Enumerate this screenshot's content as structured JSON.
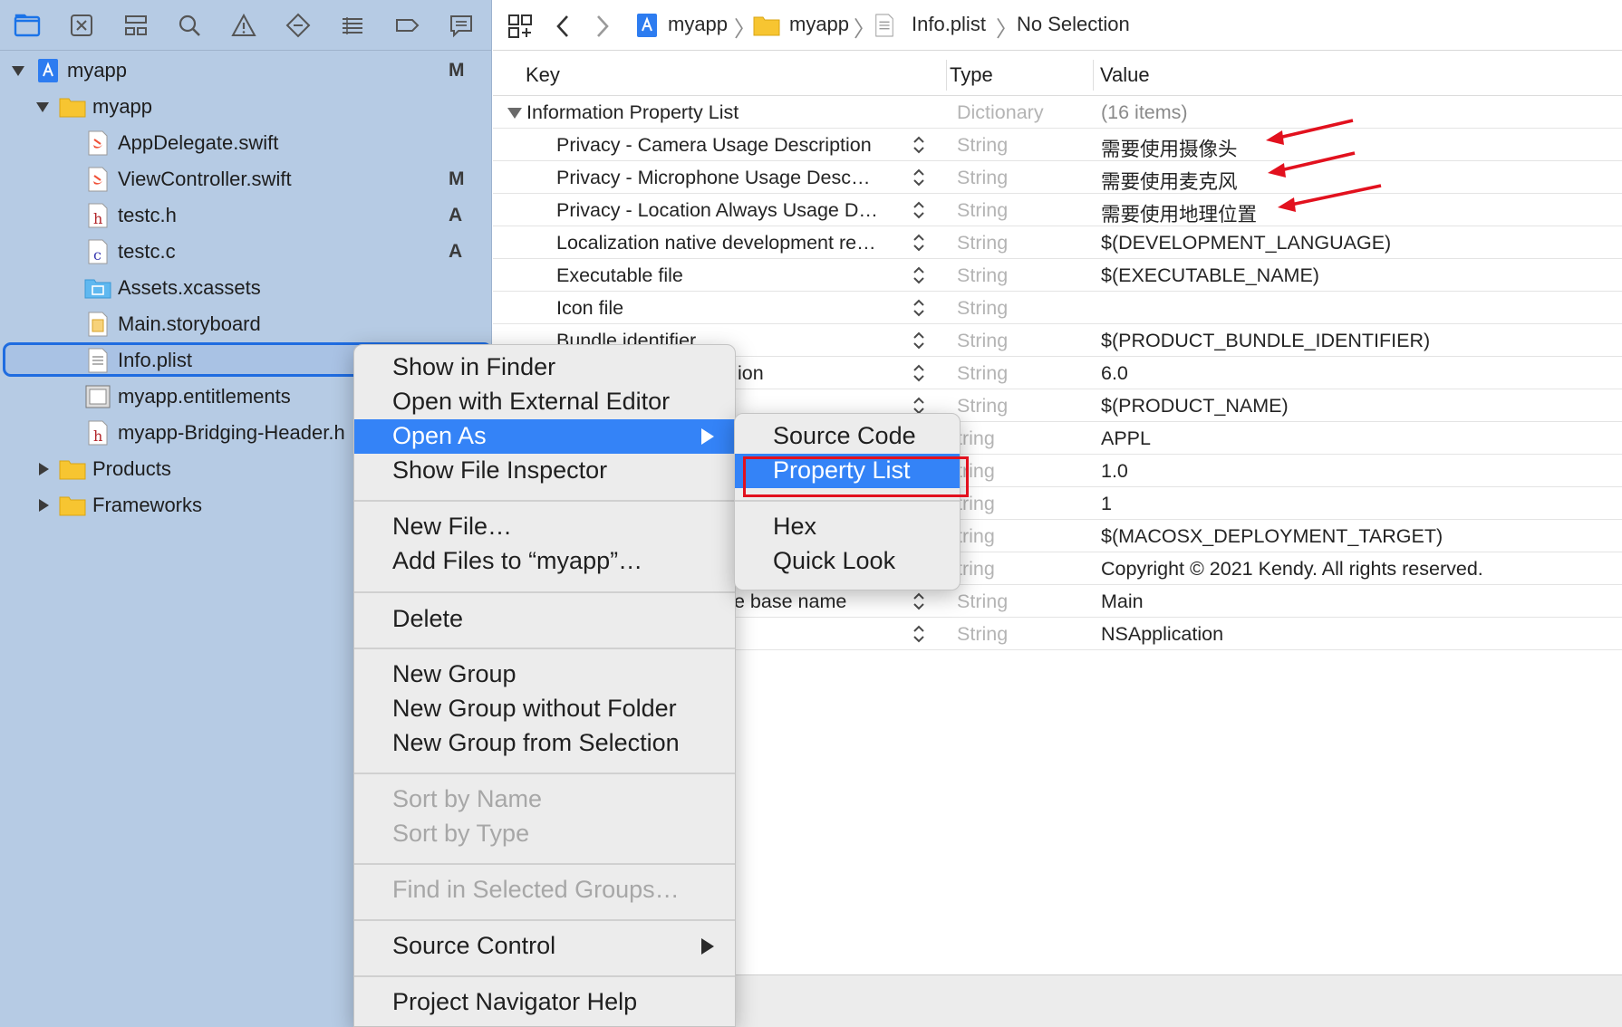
{
  "navigator": {
    "toolbar_icons": [
      "folder-icon",
      "source-control-icon",
      "symbol-icon",
      "find-icon",
      "issue-icon",
      "test-icon",
      "debug-icon",
      "breakpoint-icon",
      "report-icon"
    ],
    "tree": [
      {
        "label": "myapp",
        "badge": "M",
        "icon": "project-icon",
        "disclosure": "open"
      },
      {
        "label": "myapp",
        "badge": "",
        "icon": "folder-icon",
        "disclosure": "open"
      },
      {
        "label": "AppDelegate.swift",
        "badge": "",
        "icon": "swift-file-icon"
      },
      {
        "label": "ViewController.swift",
        "badge": "M",
        "icon": "swift-file-icon"
      },
      {
        "label": "testc.h",
        "badge": "A",
        "icon": "header-file-icon"
      },
      {
        "label": "testc.c",
        "badge": "A",
        "icon": "c-file-icon"
      },
      {
        "label": "Assets.xcassets",
        "badge": "",
        "icon": "asset-catalog-icon"
      },
      {
        "label": "Main.storyboard",
        "badge": "",
        "icon": "storyboard-icon"
      },
      {
        "label": "Info.plist",
        "badge": "",
        "icon": "plist-file-icon",
        "selected": true
      },
      {
        "label": "myapp.entitlements",
        "badge": "",
        "icon": "entitlements-icon"
      },
      {
        "label": "myapp-Bridging-Header.h",
        "badge": "",
        "icon": "header-file-icon"
      },
      {
        "label": "Products",
        "badge": "",
        "icon": "folder-icon",
        "disclosure": "closed"
      },
      {
        "label": "Frameworks",
        "badge": "",
        "icon": "folder-icon",
        "disclosure": "closed"
      }
    ]
  },
  "jumpbar": {
    "crumbs": [
      "myapp",
      "myapp",
      "Info.plist",
      "No Selection"
    ]
  },
  "plist": {
    "headers": {
      "key": "Key",
      "type": "Type",
      "value": "Value"
    },
    "root": {
      "key": "Information Property List",
      "type": "Dictionary",
      "value": "(16 items)"
    },
    "rows": [
      {
        "key": "Privacy - Camera Usage Description",
        "type": "String",
        "value": "需要使用摄像头"
      },
      {
        "key": "Privacy - Microphone Usage Desc…",
        "type": "String",
        "value": "需要使用麦克风"
      },
      {
        "key": "Privacy - Location Always Usage D…",
        "type": "String",
        "value": "需要使用地理位置"
      },
      {
        "key": "Localization native development re…",
        "type": "String",
        "value": "$(DEVELOPMENT_LANGUAGE)"
      },
      {
        "key": "Executable file",
        "type": "String",
        "value": "$(EXECUTABLE_NAME)"
      },
      {
        "key": "Icon file",
        "type": "String",
        "value": ""
      },
      {
        "key": "Bundle identifier",
        "type": "String",
        "value": "$(PRODUCT_BUNDLE_IDENTIFIER)"
      },
      {
        "key": "ion",
        "type": "String",
        "value": "6.0"
      },
      {
        "key": "",
        "type": "String",
        "value": "$(PRODUCT_NAME)"
      },
      {
        "key": "",
        "type": "tring",
        "value": "APPL"
      },
      {
        "key": "",
        "type": "tring",
        "value": "1.0"
      },
      {
        "key": "",
        "type": "tring",
        "value": "1"
      },
      {
        "key": "",
        "type": "tring",
        "value": "$(MACOSX_DEPLOYMENT_TARGET)"
      },
      {
        "key": "",
        "type": "tring",
        "value": "Copyright © 2021 Kendy. All rights reserved."
      },
      {
        "key": "e base name",
        "type": "String",
        "value": "Main"
      },
      {
        "key": "",
        "type": "String",
        "value": "NSApplication"
      }
    ]
  },
  "context_menu": {
    "show_in_finder": "Show in Finder",
    "open_external": "Open with External Editor",
    "open_as": "Open As",
    "show_inspector": "Show File Inspector",
    "new_file": "New File…",
    "add_files": "Add Files to “myapp”…",
    "delete": "Delete",
    "new_group": "New Group",
    "new_group_no_folder": "New Group without Folder",
    "new_group_selection": "New Group from Selection",
    "sort_name": "Sort by Name",
    "sort_type": "Sort by Type",
    "find_groups": "Find in Selected Groups…",
    "source_control": "Source Control",
    "nav_help": "Project Navigator Help"
  },
  "submenu": {
    "source_code": "Source Code",
    "property_list": "Property List",
    "hex": "Hex",
    "quick_look": "Quick Look"
  },
  "colors": {
    "accent": "#3483f7",
    "annotation": "#e2111e",
    "sidebar": "#b6cbe4"
  }
}
